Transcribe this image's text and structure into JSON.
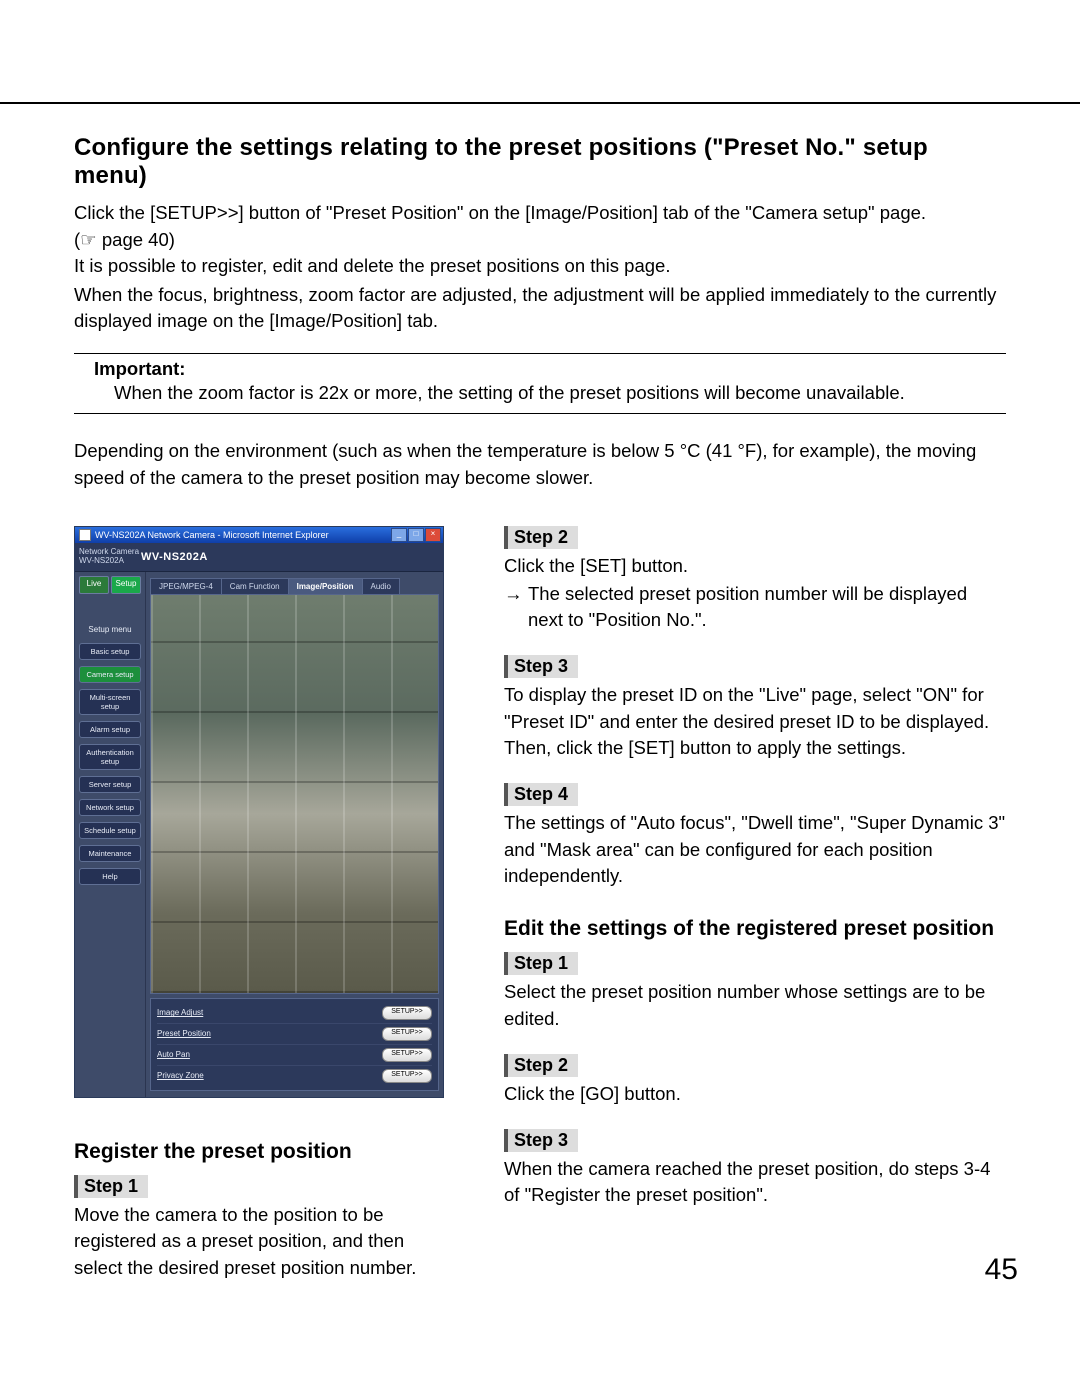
{
  "title": "Configure the settings relating to the preset positions (\"Preset No.\" setup menu)",
  "intro": {
    "p1": "Click the [SETUP>>] button of \"Preset Position\" on the [Image/Position] tab of the \"Camera setup\" page.",
    "pref": "(☞ page 40)",
    "p2": "It is possible to register, edit and delete the preset positions on this page.",
    "p3": "When the focus, brightness, zoom factor are adjusted, the adjustment will be applied immediately to the currently displayed image on the [Image/Position] tab."
  },
  "important": {
    "label": "Important:",
    "text": "When the zoom factor is 22x or more, the setting of the preset positions will become unavailable."
  },
  "note": "Depending on the environment (such as when the temperature is below 5 °C (41 °F), for example), the moving speed of the camera to the preset position may become slower.",
  "screenshot": {
    "window_title": "WV-NS202A Network Camera - Microsoft Internet Explorer",
    "brand_line1": "Network Camera",
    "brand_line2": "WV-NS202A",
    "model": "WV-NS202A",
    "mode": {
      "live": "Live",
      "setup": "Setup"
    },
    "menu_title": "Setup menu",
    "nav": [
      "Basic setup",
      "Camera setup",
      "Multi-screen setup",
      "Alarm setup",
      "Authentication setup",
      "Server setup",
      "Network setup",
      "Schedule setup",
      "Maintenance",
      "Help"
    ],
    "nav_active_index": 1,
    "tabs": [
      "JPEG/MPEG-4",
      "Cam Function",
      "Image/Position",
      "Audio"
    ],
    "tab_active_index": 2,
    "rows": [
      {
        "label": "Image Adjust",
        "btn": "SETUP>>"
      },
      {
        "label": "Preset Position",
        "btn": "SETUP>>"
      },
      {
        "label": "Auto Pan",
        "btn": "SETUP>>"
      },
      {
        "label": "Privacy Zone",
        "btn": "SETUP>>"
      }
    ]
  },
  "left": {
    "heading": "Register the preset position",
    "step1": {
      "label": "Step 1",
      "text": "Move the camera to the position to be registered as a preset position, and then select the desired preset position number."
    }
  },
  "right": {
    "step2": {
      "label": "Step 2",
      "text": "Click the [SET] button.",
      "arrow": "The selected preset position number will be displayed next to \"Position No.\"."
    },
    "step3": {
      "label": "Step 3",
      "text": "To display the preset ID on the \"Live\" page, select \"ON\" for \"Preset ID\" and enter the desired preset ID to be displayed. Then, click the [SET] button to apply the settings."
    },
    "step4": {
      "label": "Step 4",
      "text": "The settings of \"Auto focus\", \"Dwell time\", \"Super Dynamic 3\" and \"Mask area\" can be configured for each position independently."
    },
    "edit_heading": "Edit the settings of the registered preset position",
    "edit_step1": {
      "label": "Step 1",
      "text": "Select the preset position number whose settings are to be edited."
    },
    "edit_step2": {
      "label": "Step 2",
      "text": "Click the [GO] button."
    },
    "edit_step3": {
      "label": "Step 3",
      "text": "When the camera reached the preset position, do steps 3-4 of \"Register the preset position\"."
    }
  },
  "page_number": "45"
}
